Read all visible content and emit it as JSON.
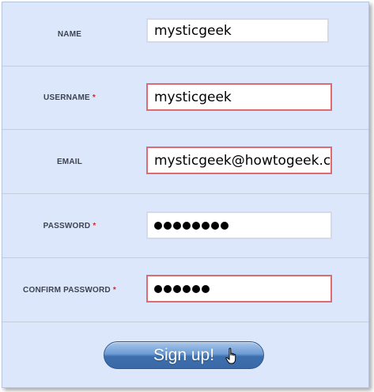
{
  "form": {
    "fields": [
      {
        "label": "NAME",
        "required": false,
        "value": "mysticgeek",
        "invalid": false
      },
      {
        "label": "USERNAME",
        "required": true,
        "value": "mysticgeek",
        "invalid": true
      },
      {
        "label": "EMAIL",
        "required": false,
        "value": "mysticgeek@howtogeek.com",
        "invalid": true
      },
      {
        "label": "PASSWORD",
        "required": true,
        "masked_length": 8,
        "invalid": false
      },
      {
        "label": "CONFIRM PASSWORD",
        "required": true,
        "masked_length": 6,
        "invalid": true
      }
    ],
    "required_marker": "*",
    "submit_label": "Sign up!"
  },
  "colors": {
    "panel_bg": "#dde7fb",
    "invalid_border": "#e06a6e",
    "required_star": "#cc2b2b",
    "button_blue": "#3d6fae"
  },
  "icons": {
    "cursor": "hand-pointer-icon"
  }
}
